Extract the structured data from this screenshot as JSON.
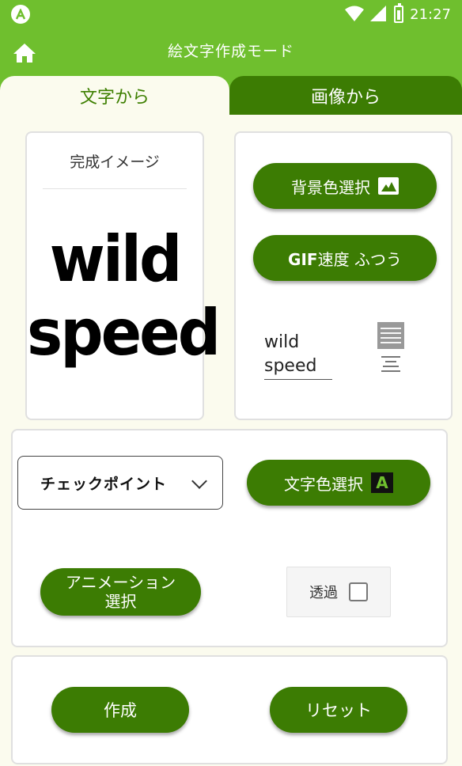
{
  "status_bar": {
    "time": "21:27"
  },
  "toolbar": {
    "title": "絵文字作成モード",
    "home_icon": "home-icon"
  },
  "tabs": [
    {
      "label": "文字から",
      "selected": true
    },
    {
      "label": "画像から",
      "selected": false
    }
  ],
  "preview": {
    "title": "完成イメージ",
    "emoji_line1": "wild",
    "emoji_line2": "speed"
  },
  "options": {
    "bg_select_label": "背景色選択",
    "gif_prefix": "GIF",
    "gif_speed_label": "速度 ふつう",
    "text_line1": "wild",
    "text_line2": "speed"
  },
  "settings": {
    "font_value": "チェックポイント",
    "text_color_label": "文字色選択",
    "text_color_icon_letter": "A",
    "animation_label_line1": "アニメーション",
    "animation_label_line2": "選択",
    "transparent_label": "透過",
    "transparent_checked": false
  },
  "actions": {
    "create_label": "作成",
    "reset_label": "リセット"
  },
  "colors": {
    "primary": "#6fbf2e",
    "dark": "#3c7c03",
    "background": "#fbfbee"
  }
}
